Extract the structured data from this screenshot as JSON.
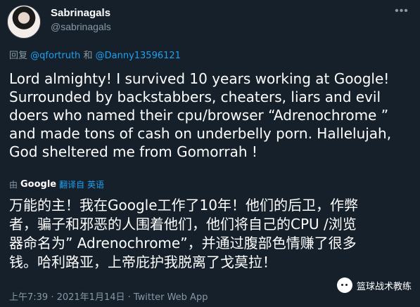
{
  "user": {
    "display_name": "Sabrinagals",
    "handle": "@sabrinagals"
  },
  "reply": {
    "prefix": "回复",
    "mention1": "@qfortruth",
    "and": "和",
    "mention2": "@Danny13596121"
  },
  "tweet": {
    "text": "Lord almighty! I survived 10 years working at Google!\nSurrounded by  backstabbers, cheaters, liars and evil\ndoers who named their cpu/browser “Adrenochrome ”\nand made tons of cash on underbelly porn. Hallelujah,\nGod sheltered me from Gomorrah !"
  },
  "translation": {
    "by": "由",
    "provider": "Google",
    "link": "翻译自 英语",
    "text": "万能的主！我在Google工作了10年！他们的后卫，作弊\n者，骗子和邪恶的人围着他们，他们将自己的CPU /浏览\n器命名为” Adrenochrome”，并通过腹部色情赚了很多\n钱。哈利路亚，上帝庇护我脱离了戈莫拉！"
  },
  "meta": {
    "timestamp": "上午7:39 · 2021年1月14日 · Twitter Web App"
  },
  "watermark": {
    "label": "篮球战术教练"
  },
  "icons": {
    "more": "more-dots-icon",
    "avatar": "avatar",
    "wechat": "wechat-icon"
  },
  "colors": {
    "background": "#15202b",
    "secondary_text": "#8899a6",
    "link": "#1da1f2",
    "primary_text": "#ffffff"
  }
}
